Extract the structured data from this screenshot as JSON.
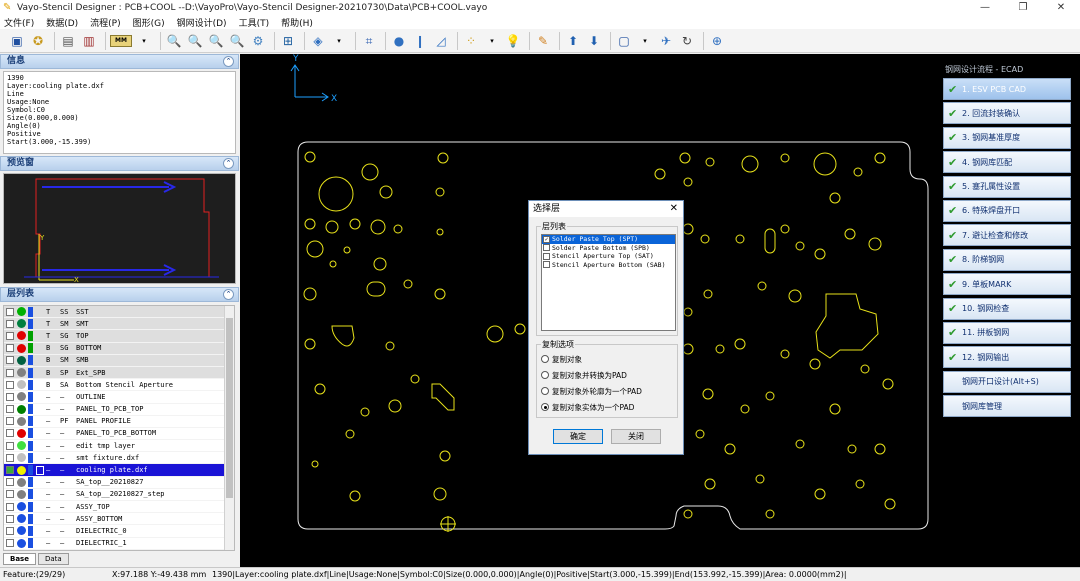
{
  "window": {
    "title": "Vayo-Stencil Designer : PCB+COOL --D:\\VayoPro\\Vayo-Stencil Designer-20210730\\Data\\PCB+COOL.vayo",
    "min": "—",
    "max": "❐",
    "close": "✕"
  },
  "menu": [
    "文件(F)",
    "数据(D)",
    "流程(P)",
    "图形(G)",
    "钢网设计(D)",
    "工具(T)",
    "帮助(H)"
  ],
  "toolbar": {
    "unit_label": "MM"
  },
  "info_panel": {
    "title": "信息",
    "lines": [
      "1390",
      "Layer:cooling plate.dxf",
      "Line",
      "Usage:None",
      "Symbol:C0",
      "Size(0.000,0.000)",
      "Angle(0)",
      "Positive",
      "Start(3.000,-15.399)"
    ]
  },
  "preview_panel": {
    "title": "预览窗",
    "x_label": "X",
    "y_label": "Y"
  },
  "layers_panel": {
    "title": "层列表",
    "rows": [
      {
        "type": "T",
        "sub": "SS",
        "name": "SST",
        "color": "#00b000",
        "gray": true
      },
      {
        "type": "T",
        "sub": "SM",
        "name": "SMT",
        "color": "#008040",
        "gray": true
      },
      {
        "type": "T",
        "sub": "SG",
        "name": "TOP",
        "color": "#e00000",
        "gray": true
      },
      {
        "type": "B",
        "sub": "SG",
        "name": "BOTTOM",
        "color": "#e00000",
        "gray": true
      },
      {
        "type": "B",
        "sub": "SM",
        "name": "SMB",
        "color": "#006040",
        "gray": true
      },
      {
        "type": "B",
        "sub": "SP",
        "name": "Ext_SPB",
        "color": "#808080",
        "gray": true
      },
      {
        "type": "B",
        "sub": "SA",
        "name": "Bottom Stencil Aperture",
        "color": "#c0c0c0",
        "gray": false
      },
      {
        "type": "—",
        "sub": "—",
        "name": "OUTLINE",
        "color": "#808080",
        "gray": false
      },
      {
        "type": "—",
        "sub": "—",
        "name": "PANEL_TO_PCB_TOP",
        "color": "#008000",
        "gray": false
      },
      {
        "type": "—",
        "sub": "PF",
        "name": "PANEL PROFILE",
        "color": "#808080",
        "gray": false
      },
      {
        "type": "—",
        "sub": "—",
        "name": "PANEL_TO_PCB_BOTTOM",
        "color": "#e00000",
        "gray": false
      },
      {
        "type": "—",
        "sub": "—",
        "name": "edit tmp layer",
        "color": "#40e040",
        "gray": false
      },
      {
        "type": "—",
        "sub": "—",
        "name": "smt fixture.dxf",
        "color": "#c0c0c0",
        "gray": false
      },
      {
        "type": "—",
        "sub": "—",
        "name": "cooling plate.dxf",
        "color": "#f0f000",
        "gray": false,
        "selected": true
      },
      {
        "type": "—",
        "sub": "—",
        "name": "SA_top__20210827",
        "color": "#808080",
        "gray": false
      },
      {
        "type": "—",
        "sub": "—",
        "name": "SA_top__20210827_step",
        "color": "#808080",
        "gray": false
      },
      {
        "type": "—",
        "sub": "—",
        "name": "ASSY_TOP",
        "color": "#1a4fe0",
        "gray": false
      },
      {
        "type": "—",
        "sub": "—",
        "name": "ASSY_BOTTOM",
        "color": "#1a4fe0",
        "gray": false
      },
      {
        "type": "—",
        "sub": "—",
        "name": "DIELECTRIC_0",
        "color": "#1a4fe0",
        "gray": false
      },
      {
        "type": "—",
        "sub": "—",
        "name": "DIELECTRIC_1",
        "color": "#1a4fe0",
        "gray": false
      }
    ]
  },
  "tabs": [
    "Base",
    "Data"
  ],
  "canvas": {
    "x_label": "X",
    "y_label": "Y"
  },
  "flow": {
    "title": "钢网设计流程 - ECAD",
    "steps": [
      {
        "label": "1.  ESV PCB CAD",
        "active": true
      },
      {
        "label": "2.  回流封装确认"
      },
      {
        "label": "3.  钢网基准厚度"
      },
      {
        "label": "4.  钢网库匹配"
      },
      {
        "label": "5.  塞孔属性设置"
      },
      {
        "label": "6.  特殊焊盘开口"
      },
      {
        "label": "7.  避让检查和修改"
      },
      {
        "label": "8.  阶梯钢网"
      },
      {
        "label": "9.  单板MARK"
      },
      {
        "label": "10.  钢网检查"
      },
      {
        "label": "11.  拼板钢网"
      },
      {
        "label": "12.  钢网输出"
      }
    ],
    "buttons": [
      "钢网开口设计(Alt+S)",
      "钢网库管理"
    ]
  },
  "dialog": {
    "title": "选择层",
    "list_group": "层列表",
    "layers": [
      {
        "name": "Solder Paste Top (SPT)",
        "checked": true
      },
      {
        "name": "Solder Paste Bottom (SPB)",
        "checked": false
      },
      {
        "name": "Stencil Aperture Top (SAT)",
        "checked": false
      },
      {
        "name": "Stencil Aperture Bottom (SAB)",
        "checked": false
      }
    ],
    "copy_group": "复制选项",
    "options": [
      "复制对象",
      "复制对象并转换为PAD",
      "复制对象外轮廓为一个PAD",
      "复制对象实体为一个PAD"
    ],
    "selected_option": 3,
    "ok": "确定",
    "cancel": "关闭"
  },
  "status": {
    "feature": "Feature:(29/29)",
    "coords": "X:97.188 Y:-49.438 mm",
    "detail": "1390|Layer:cooling plate.dxf|Line|Usage:None|Symbol:C0|Size(0.000,0.000)|Angle(0)|Positive|Start(3.000,-15.399)|End(153.992,-15.399)|Area: 0.0000(mm2)|"
  }
}
